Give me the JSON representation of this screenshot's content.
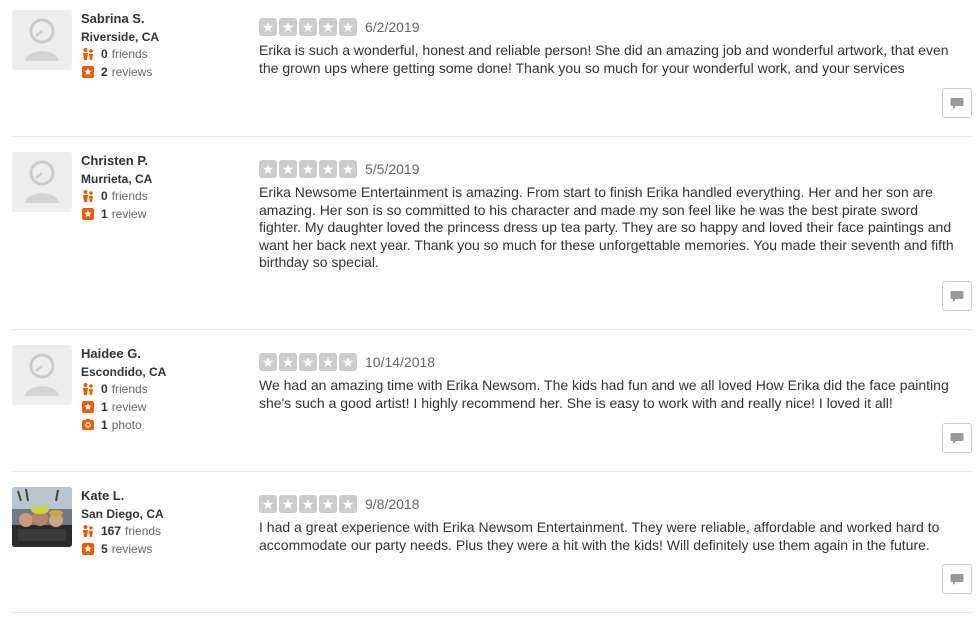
{
  "colors": {
    "accent": "#f15c00",
    "star_empty": "#cccccc",
    "divider": "#e6e6e6"
  },
  "reviews": [
    {
      "name": "Sabrina S.",
      "location": "Riverside, CA",
      "friends_count": "0",
      "friends_label": "friends",
      "reviews_count": "2",
      "reviews_label": "reviews",
      "rating": 5,
      "date": "6/2/2019",
      "text": "Erika is such a wonderful, honest and reliable person! She did an amazing job and wonderful artwork, that even the grown ups where getting some done! Thank you so much for your wonderful work, and your services",
      "avatar": "default-avatar-icon"
    },
    {
      "name": "Christen P.",
      "location": "Murrieta, CA",
      "friends_count": "0",
      "friends_label": "friends",
      "reviews_count": "1",
      "reviews_label": "review",
      "rating": 5,
      "date": "5/5/2019",
      "text": "Erika Newsome Entertainment is amazing. From start to finish Erika handled everything. Her and her son are amazing. Her son is so committed to his character and made my son feel like he was the best pirate sword fighter. My daughter loved the princess dress up tea party. They are so happy and loved their face paintings and want her back next year. Thank you so much for these unforgettable memories. You made their seventh and fifth birthday so special.",
      "avatar": "default-avatar-icon"
    },
    {
      "name": "Haidee G.",
      "location": "Escondido, CA",
      "friends_count": "0",
      "friends_label": "friends",
      "reviews_count": "1",
      "reviews_label": "review",
      "photos_count": "1",
      "photos_label": "photo",
      "rating": 5,
      "date": "10/14/2018",
      "text": "We had an amazing time with Erika Newsom. The kids had fun and we all loved How Erika did the face  painting she's such a good artist! I highly recommend her. She is easy to work with and really nice! I loved it all!",
      "avatar": "default-avatar-icon"
    },
    {
      "name": "Kate L.",
      "location": "San Diego, CA",
      "friends_count": "167",
      "friends_label": "friends",
      "reviews_count": "5",
      "reviews_label": "reviews",
      "rating": 5,
      "date": "9/8/2018",
      "text": "I had a great experience with Erika Newsom Entertainment. They were reliable, affordable and worked hard to accommodate our party needs. Plus they were a hit with the kids! Will definitely use them again in the future.",
      "avatar": "user-photo"
    }
  ]
}
